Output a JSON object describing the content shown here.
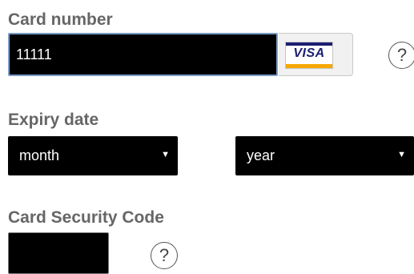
{
  "card_number": {
    "label": "Card number",
    "value": "11111",
    "brand_logo_text": "VISA",
    "brand_colors": {
      "navy": "#1a1f71",
      "gold": "#f7a800"
    },
    "help_text": "?"
  },
  "expiry": {
    "label": "Expiry date",
    "month": {
      "selected": "month"
    },
    "year": {
      "selected": "year"
    },
    "arrow": "▼"
  },
  "security_code": {
    "label": "Card Security Code",
    "value": "",
    "help_text": "?"
  }
}
